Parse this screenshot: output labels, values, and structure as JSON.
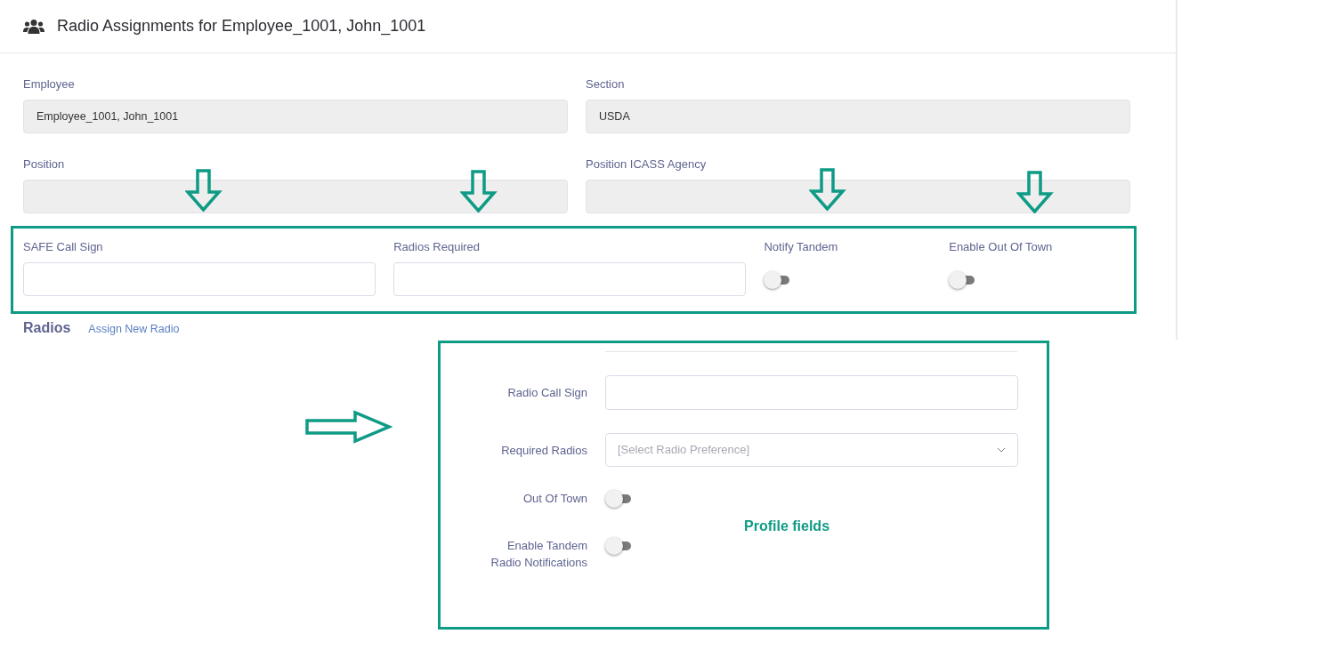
{
  "header": {
    "title": "Radio Assignments for Employee_1001, John_1001"
  },
  "fields": [
    {
      "label": "Employee",
      "value": "Employee_1001, John_1001"
    },
    {
      "label": "Section",
      "value": "USDA"
    },
    {
      "label": "Position"
    },
    {
      "label": "Position ICASS Agency"
    }
  ],
  "highlighted_fields": [
    {
      "kind": "text",
      "label": "SAFE Call Sign"
    },
    {
      "kind": "text",
      "label": "Radios Required"
    },
    {
      "kind": "toggle",
      "label": "Notify Tandem",
      "on": false
    },
    {
      "kind": "toggle",
      "label": "Enable Out Of Town",
      "on": false
    }
  ],
  "radios": {
    "title": "Radios",
    "link": "Assign New Radio"
  },
  "profile_panel": {
    "fields": [
      {
        "kind": "text",
        "label": "Radio Call Sign"
      },
      {
        "kind": "select",
        "label": "Required Radios",
        "placeholder": "[Select Radio Preference]"
      },
      {
        "kind": "toggle",
        "label": "Out Of Town",
        "on": false
      },
      {
        "kind": "toggle",
        "label": "Enable Tandem Radio Notifications",
        "on": false
      }
    ],
    "annotation": "Profile fields"
  }
}
